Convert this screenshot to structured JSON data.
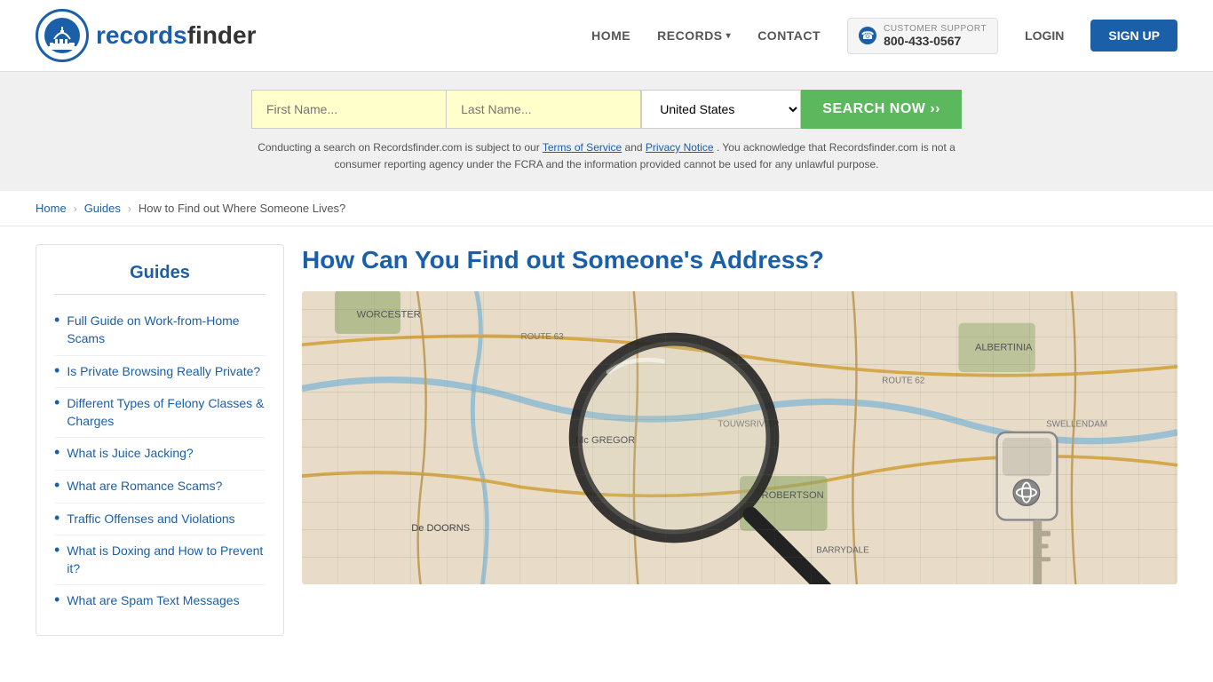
{
  "header": {
    "logo_text_records": "records",
    "logo_text_finder": "finder",
    "nav": {
      "home": "HOME",
      "records": "RECORDS",
      "records_chevron": "▾",
      "contact": "CONTACT",
      "support_label": "CUSTOMER SUPPORT",
      "support_number": "800-433-0567",
      "login": "LOGIN",
      "signup": "SIGN UP"
    }
  },
  "search": {
    "first_name_placeholder": "First Name...",
    "last_name_placeholder": "Last Name...",
    "state_value": "United States",
    "button_label": "SEARCH NOW ››",
    "disclaimer_text": "Conducting a search on Recordsfinder.com is subject to our",
    "tos_link": "Terms of Service",
    "and_text": "and",
    "privacy_link": "Privacy Notice",
    "disclaimer_rest": ". You acknowledge that Recordsfinder.com is not a consumer reporting agency under the FCRA and the information provided cannot be used for any unlawful purpose."
  },
  "breadcrumb": {
    "home": "Home",
    "guides": "Guides",
    "current": "How to Find out Where Someone Lives?"
  },
  "sidebar": {
    "title": "Guides",
    "items": [
      {
        "label": "Full Guide on Work-from-Home Scams"
      },
      {
        "label": "Is Private Browsing Really Private?"
      },
      {
        "label": "Different Types of Felony Classes & Charges"
      },
      {
        "label": "What is Juice Jacking?"
      },
      {
        "label": "What are Romance Scams?"
      },
      {
        "label": "Traffic Offenses and Violations"
      },
      {
        "label": "What is Doxing and How to Prevent it?"
      },
      {
        "label": "What are Spam Text Messages"
      }
    ]
  },
  "article": {
    "title": "How Can You Find out Someone's Address?",
    "image_alt": "Map with magnifying glass and car key"
  },
  "colors": {
    "blue": "#1a5fa8",
    "green": "#5cb85c",
    "input_bg": "#ffffcc"
  }
}
